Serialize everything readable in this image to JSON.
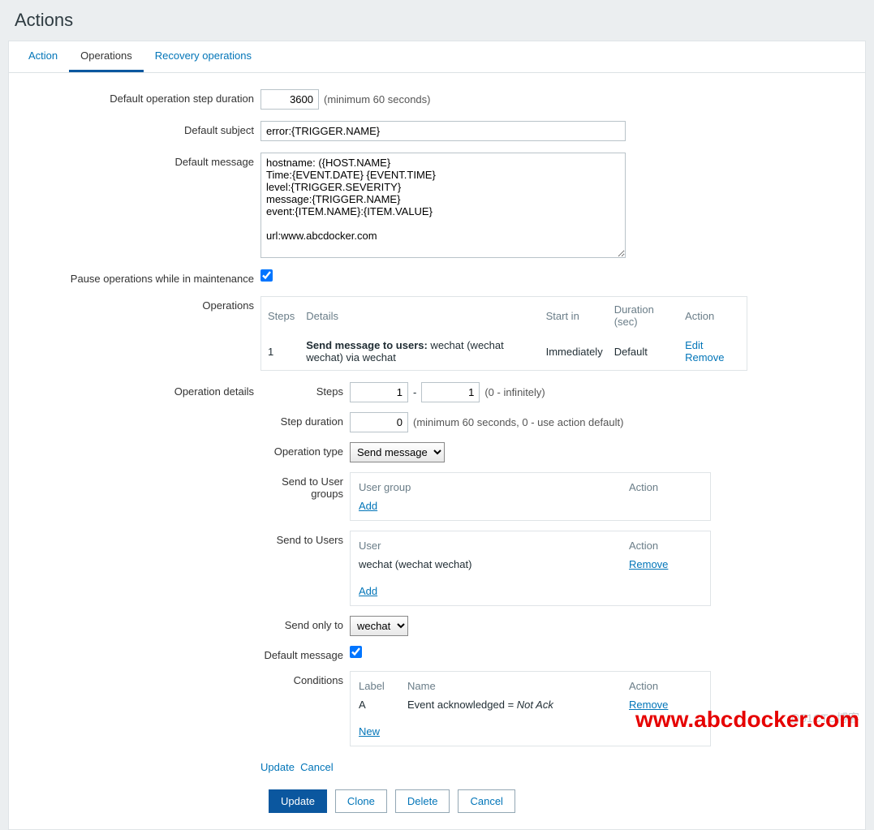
{
  "title": "Actions",
  "tabs": {
    "action": "Action",
    "operations": "Operations",
    "recovery": "Recovery operations"
  },
  "labels": {
    "duration": "Default operation step duration",
    "subject": "Default subject",
    "message": "Default message",
    "pause": "Pause operations while in maintenance",
    "operations": "Operations",
    "opdetails": "Operation details",
    "steps": "Steps",
    "stepduration": "Step duration",
    "optype": "Operation type",
    "sendgroups": "Send to User groups",
    "sendusers": "Send to Users",
    "sendonly": "Send only to",
    "defmsg": "Default message",
    "conditions": "Conditions"
  },
  "values": {
    "duration": "3600",
    "subject": "error:{TRIGGER.NAME}",
    "message": "hostname: ({HOST.NAME}\nTime:{EVENT.DATE} {EVENT.TIME}\nlevel:{TRIGGER.SEVERITY}\nmessage:{TRIGGER.NAME}\nevent:{ITEM.NAME}:{ITEM.VALUE}\n\nurl:www.abcdocker.com",
    "step_from": "1",
    "step_to": "1",
    "step_dur": "0",
    "optype": "Send message",
    "sendonly": "wechat"
  },
  "hints": {
    "min60": "(minimum 60 seconds)",
    "inf": "(0 - infinitely)",
    "stepdur": "(minimum 60 seconds, 0 - use action default)"
  },
  "optable": {
    "h_steps": "Steps",
    "h_details": "Details",
    "h_start": "Start in",
    "h_dur": "Duration (sec)",
    "h_action": "Action",
    "row": {
      "steps": "1",
      "boldpart": "Send message to users:",
      "rest": " wechat (wechat wechat) via wechat",
      "start": "Immediately",
      "dur": "Default",
      "edit": "Edit",
      "remove": "Remove"
    }
  },
  "groups": {
    "h_group": "User group",
    "h_action": "Action",
    "add": "Add"
  },
  "users": {
    "h_user": "User",
    "h_action": "Action",
    "user": "wechat (wechat wechat)",
    "remove": "Remove",
    "add": "Add"
  },
  "cond": {
    "h_label": "Label",
    "h_name": "Name",
    "h_action": "Action",
    "label": "A",
    "name_pre": "Event acknowledged = ",
    "name_it": "Not Ack",
    "remove": "Remove",
    "new": "New"
  },
  "links": {
    "update": "Update",
    "cancel": "Cancel"
  },
  "buttons": {
    "update": "Update",
    "clone": "Clone",
    "delete": "Delete",
    "cancel": "Cancel"
  },
  "watermark": "www.abcdocker.com",
  "watermark2": "@51CTO博客"
}
